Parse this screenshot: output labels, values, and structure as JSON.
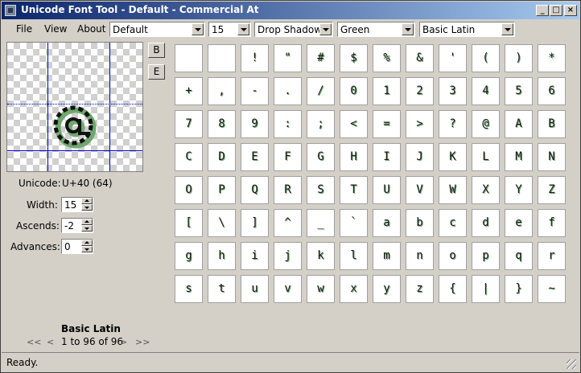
{
  "window": {
    "title": "Unicode Font Tool - Default - Commercial At",
    "controls": [
      "_",
      "□",
      "×"
    ]
  },
  "menu": [
    "File",
    "View",
    "About"
  ],
  "toolbar": {
    "font": "Default",
    "size": "15",
    "effect": "Drop Shadow",
    "color": "Green",
    "block": "Basic Latin"
  },
  "side_buttons": {
    "b": "B",
    "e": "E"
  },
  "info": {
    "unicode_label": "Unicode:",
    "unicode_value": "U+40 (64)",
    "width_label": "Width:",
    "width_value": "15",
    "ascends_label": "Ascends:",
    "ascends_value": "-2",
    "advances_label": "Advances:",
    "advances_value": "0"
  },
  "pager": {
    "block_name": "Basic Latin",
    "first": "<<",
    "prev": "<",
    "range": "1 to 96 of 96",
    "next": ">",
    "last": ">>"
  },
  "glyphs": [
    " ",
    " ",
    "!",
    "\"",
    "#",
    "$",
    "%",
    "&",
    "'",
    "(",
    ")",
    "*",
    "+",
    ",",
    "-",
    ".",
    "/",
    "0",
    "1",
    "2",
    "3",
    "4",
    "5",
    "6",
    "7",
    "8",
    "9",
    ":",
    ";",
    "<",
    "=",
    ">",
    "?",
    "@",
    "A",
    "B",
    "C",
    "D",
    "E",
    "F",
    "G",
    "H",
    "I",
    "J",
    "K",
    "L",
    "M",
    "N",
    "O",
    "P",
    "Q",
    "R",
    "S",
    "T",
    "U",
    "V",
    "W",
    "X",
    "Y",
    "Z",
    "[",
    "\\",
    "]",
    "^",
    "_",
    "`",
    "a",
    "b",
    "c",
    "d",
    "e",
    "f",
    "g",
    "h",
    "i",
    "j",
    "k",
    "l",
    "m",
    "n",
    "o",
    "p",
    "q",
    "r",
    "s",
    "t",
    "u",
    "v",
    "w",
    "x",
    "y",
    "z",
    "{",
    "|",
    "}",
    "~"
  ],
  "selected_index": 33,
  "colors": {
    "shadow": "#6fa86f",
    "guide": "#0000c8",
    "title_start": "#0a246a",
    "title_end": "#a6caf0"
  },
  "status": "Ready."
}
